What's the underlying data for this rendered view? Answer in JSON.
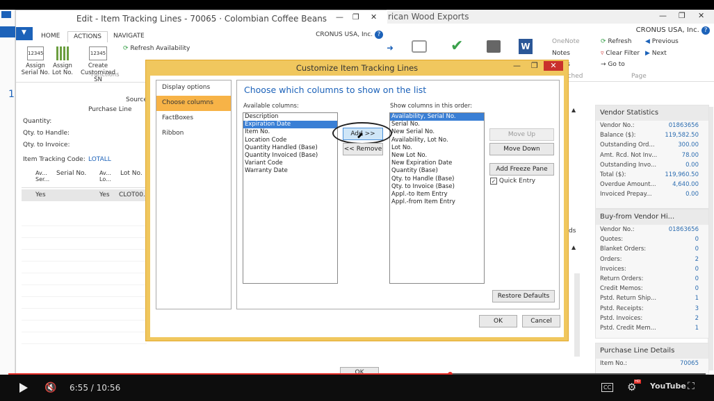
{
  "video": {
    "time": "6:55 / 10:56",
    "progress": 0.633,
    "logo": "YouTube",
    "hd": "HD",
    "cc": "CC"
  },
  "bgwindow": {
    "title": "rican Wood Exports",
    "company": "CRONUS USA, Inc.",
    "ribbon": {
      "onenote": "OneNote",
      "notes": "Notes",
      "links": "ks",
      "attached": "Attached",
      "refresh": "Refresh",
      "clear_filter": "Clear Filter",
      "previous": "Previous",
      "next": "Next",
      "goto": "Go to",
      "page": "Page"
    },
    "side_ds": "ds"
  },
  "vendor_stats": {
    "title": "Vendor Statistics",
    "rows": [
      {
        "label": "Vendor No.:",
        "value": "01863656"
      },
      {
        "label": "Balance ($):",
        "value": "119,582.50"
      },
      {
        "label": "Outstanding Ord...",
        "value": "300.00"
      },
      {
        "label": "Amt. Rcd. Not Inv...",
        "value": "78.00"
      },
      {
        "label": "Outstanding Invo...",
        "value": "0.00"
      },
      {
        "label": "Total ($):",
        "value": "119,960.50"
      },
      {
        "label": "Overdue Amount...",
        "value": "4,640.00"
      },
      {
        "label": "Invoiced Prepay...",
        "value": "0.00"
      }
    ]
  },
  "buy_from": {
    "title": "Buy-from Vendor Hi...",
    "rows": [
      {
        "label": "Vendor No.:",
        "value": "01863656"
      },
      {
        "label": "Quotes:",
        "value": "0"
      },
      {
        "label": "Blanket Orders:",
        "value": "0"
      },
      {
        "label": "Orders:",
        "value": "2"
      },
      {
        "label": "Invoices:",
        "value": "0"
      },
      {
        "label": "Return Orders:",
        "value": "0"
      },
      {
        "label": "Credit Memos:",
        "value": "0"
      },
      {
        "label": "Pstd. Return Ship...",
        "value": "1"
      },
      {
        "label": "Pstd. Receipts:",
        "value": "3"
      },
      {
        "label": "Pstd. Invoices:",
        "value": "2"
      },
      {
        "label": "Pstd. Credit Mem...",
        "value": "1"
      }
    ]
  },
  "purchase_line": {
    "title": "Purchase Line Details",
    "rows": [
      {
        "label": "Item No.:",
        "value": "70065"
      }
    ]
  },
  "lwindow": {
    "title": "Edit - Item Tracking Lines - 70065 · Colombian Coffee Beans",
    "company": "CRONUS USA, Inc.",
    "tabs": [
      "HOME",
      "ACTIONS",
      "NAVIGATE"
    ],
    "buttons": [
      {
        "l1": "Assign",
        "l2": "Serial No."
      },
      {
        "l1": "Assign",
        "l2": "Lot No."
      },
      {
        "l1": "Create",
        "l2": "Customized SN"
      }
    ],
    "refresh": "Refresh Availability",
    "functions": "Functions",
    "source": "Source",
    "purchase_line": "Purchase Line",
    "fields": [
      "Quantity:",
      "Qty. to Handle:",
      "Qty. to Invoice:"
    ],
    "tracking_code_label": "Item Tracking Code:",
    "tracking_code": "LOTALL",
    "cols": [
      "Av... Ser...",
      "Serial No.",
      "Av... Lo...",
      "Lot No."
    ],
    "row": [
      "Yes",
      "",
      "Yes",
      "CLOT00..."
    ],
    "ok": "OK"
  },
  "dialog": {
    "title": "Customize Item Tracking Lines",
    "nav": [
      "Display options",
      "Choose columns",
      "FactBoxes",
      "Ribbon"
    ],
    "heading": "Choose which columns to show on the list",
    "available_label": "Available columns:",
    "available": [
      "Description",
      "Expiration Date",
      "Item No.",
      "Location Code",
      "Quantity Handled (Base)",
      "Quantity Invoiced (Base)",
      "Variant Code",
      "Warranty Date"
    ],
    "show_label": "Show columns in this order:",
    "shown": [
      "Availability, Serial No.",
      "Serial No.",
      "New Serial No.",
      "Availability, Lot No.",
      "Lot No.",
      "New Lot No.",
      "New Expiration Date",
      "Quantity (Base)",
      "Qty. to Handle (Base)",
      "Qty. to Invoice (Base)",
      "Appl.-to Item Entry",
      "Appl.-from Item Entry"
    ],
    "add": "Add >>",
    "remove": "<< Remove",
    "move_up": "Move Up",
    "move_down": "Move Down",
    "freeze": "Add Freeze Pane",
    "quick_entry": "Quick Entry",
    "restore": "Restore Defaults",
    "ok": "OK",
    "cancel": "Cancel"
  }
}
